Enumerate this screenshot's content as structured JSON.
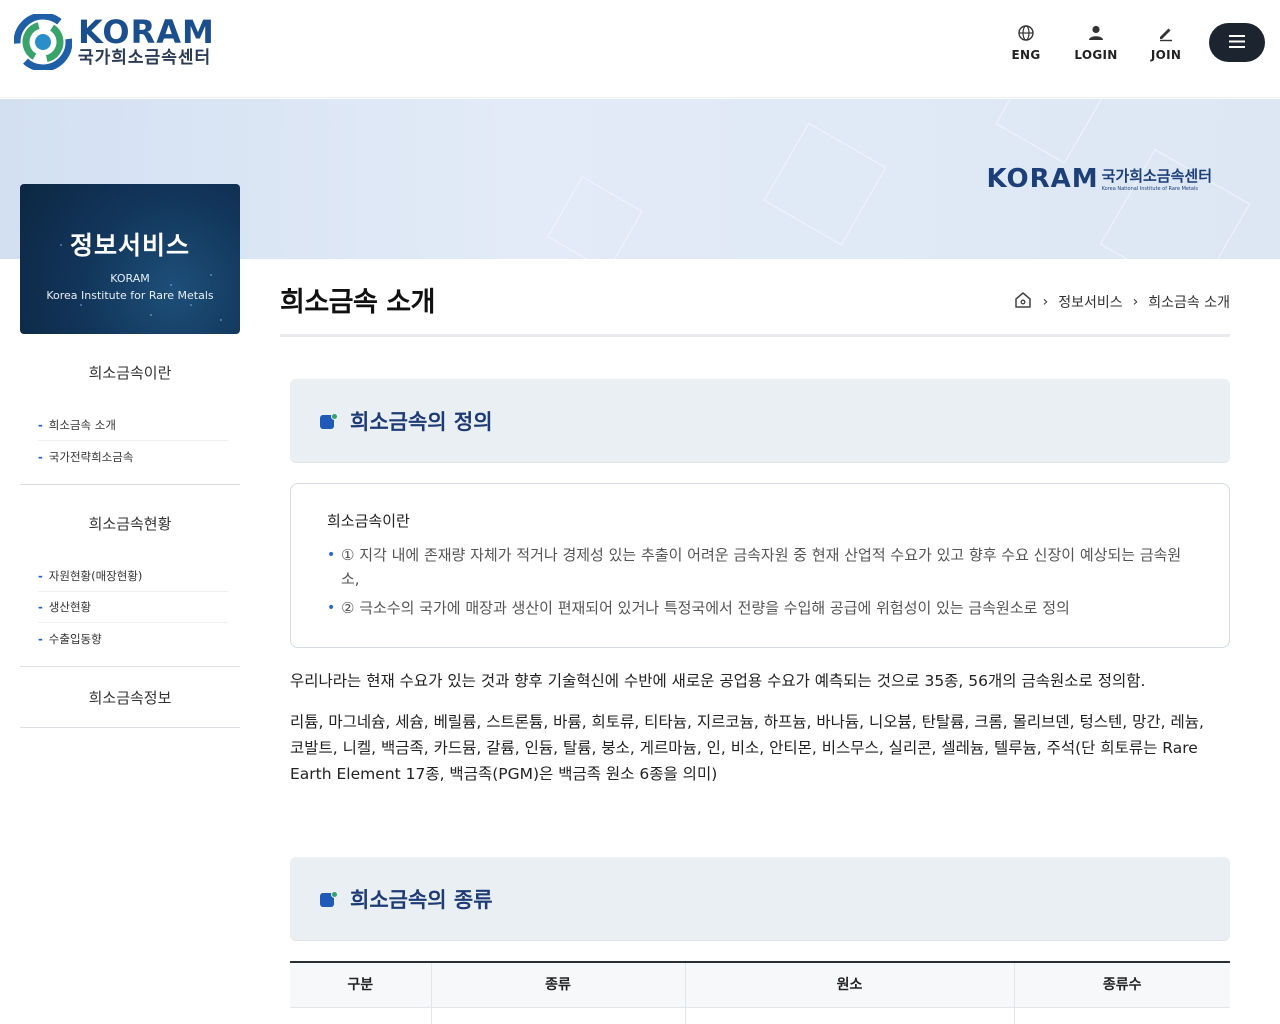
{
  "header": {
    "logo_en": "KORAM",
    "logo_ko": "국가희소금속센터",
    "util": [
      {
        "label": "ENG",
        "icon": "globe-icon"
      },
      {
        "label": "LOGIN",
        "icon": "user-icon"
      },
      {
        "label": "JOIN",
        "icon": "pencil-icon"
      }
    ],
    "menu_icon": "hamburger-icon"
  },
  "hero": {
    "logo_en": "KORAM",
    "logo_ko": "국가희소금속센터",
    "logo_sub": "Korea National Institute of Rare Metals"
  },
  "sidebar": {
    "card_title": "정보서비스",
    "card_sub1": "KORAM",
    "card_sub2": "Korea Institute for Rare Metals",
    "groups": [
      {
        "title": "희소금속이란",
        "items": [
          "희소금속 소개",
          "국가전략희소금속"
        ]
      },
      {
        "title": "희소금속현황",
        "items": [
          "자원현황(매장현황)",
          "생산현황",
          "수출입동향"
        ]
      },
      {
        "title": "희소금속정보",
        "items": []
      }
    ]
  },
  "main": {
    "page_title": "희소금속 소개",
    "breadcrumb": [
      "정보서비스",
      "희소금속 소개"
    ],
    "section1_title": "희소금속의 정의",
    "def_heading": "희소금속이란",
    "def_items": [
      "① 지각 내에 존재량 자체가 적거나 경제성 있는 추출이 어려운 금속자원 중 현재 산업적 수요가 있고 향후 수요 신장이 예상되는 금속원소,",
      "② 극소수의 국가에 매장과 생산이 편재되어 있거나 특정국에서 전량을 수입해 공급에 위험성이 있는 금속원소로 정의"
    ],
    "para1": "우리나라는 현재 수요가 있는 것과 향후 기술혁신에 수반에 새로운 공업용 수요가 예측되는 것으로 35종, 56개의 금속원소로 정의함.",
    "para2": "리튬, 마그네슘, 세슘, 베릴륨, 스트론튬, 바륨, 희토류, 티타늄, 지르코늄, 하프늄, 바나듐, 니오븀, 탄탈륨, 크롬, 몰리브덴, 텅스텐, 망간, 레늄, 코발트, 니켈, 백금족, 카드뮴, 갈륨, 인듐, 탈륨, 붕소, 게르마늄, 인, 비소, 안티몬, 비스무스, 실리콘, 셀레늄, 텔루늄, 주석(단 희토류는 Rare Earth Element 17종, 백금족(PGM)은 백금족 원소 6종을 의미)",
    "section2_title": "희소금속의 종류",
    "table_headers": [
      "구분",
      "종류",
      "원소",
      "종류수"
    ]
  }
}
